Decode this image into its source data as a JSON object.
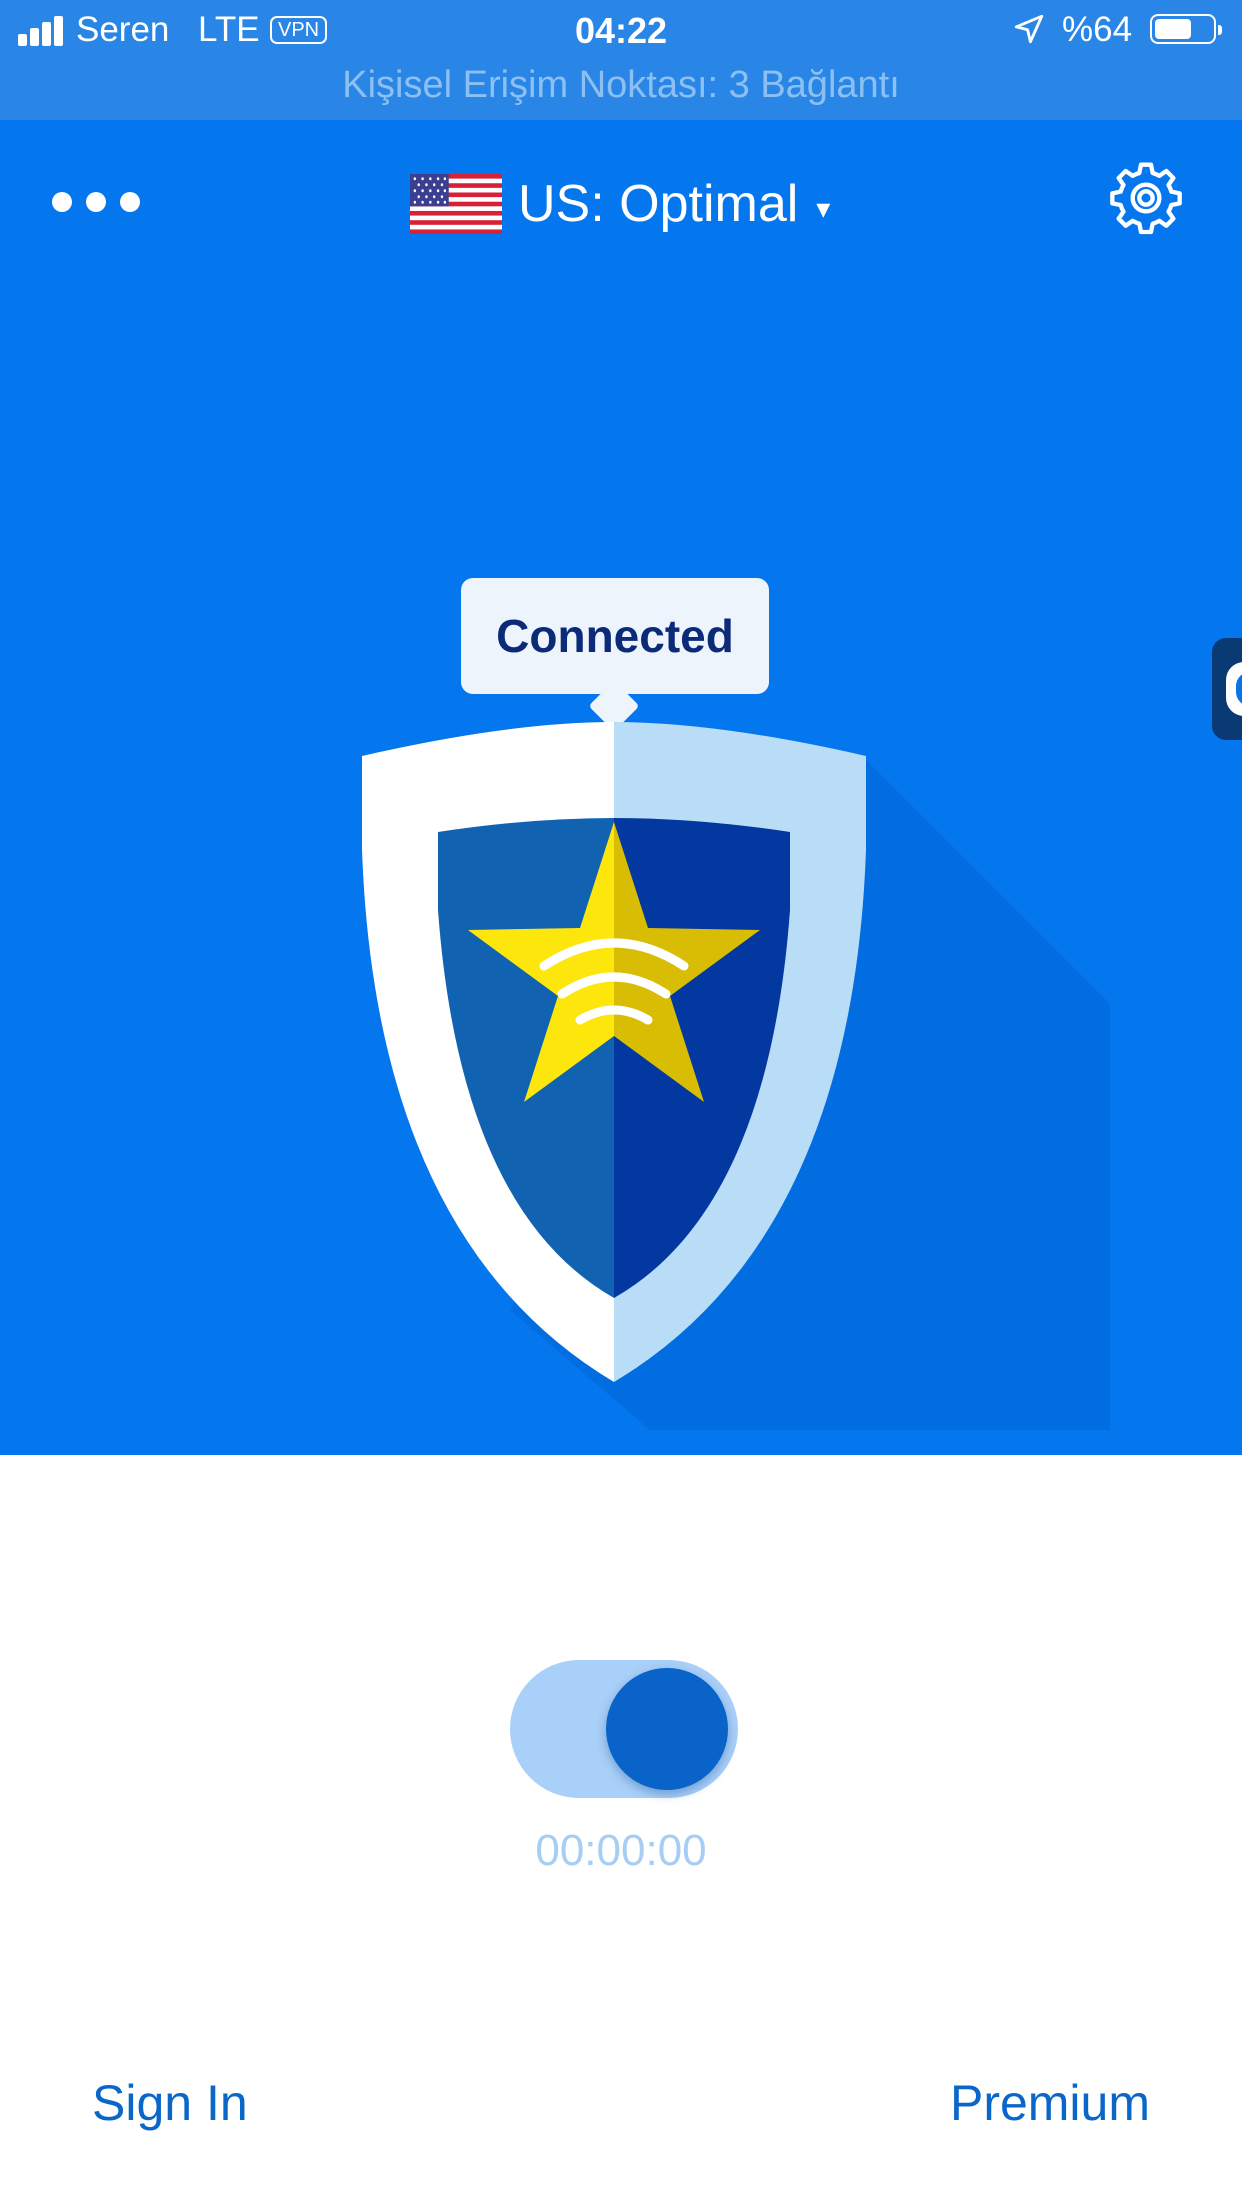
{
  "status_bar": {
    "carrier": "Seren",
    "network": "LTE",
    "vpn_badge": "VPN",
    "time": "04:22",
    "battery_percent": "%64",
    "battery_level": 0.64,
    "hotspot_text": "Kişisel Erişim Noktası: 3 Bağlantı"
  },
  "header": {
    "location_label": "US: Optimal",
    "dropdown_arrow": "▾",
    "flag_icon": "us-flag-icon",
    "more_icon": "more-dots-icon",
    "settings_icon": "gear-icon"
  },
  "hero": {
    "status_text": "Connected",
    "graphic_icon": "shield-star-wifi-icon"
  },
  "connection": {
    "toggle_on": true,
    "timer": "00:00:00"
  },
  "footer": {
    "sign_in_label": "Sign In",
    "premium_label": "Premium"
  },
  "colors": {
    "hero_background": "#0476ee",
    "status_bar_background": "#2a86e6",
    "link": "#0a67c9",
    "toggle_track": "#a9d0f8",
    "toggle_knob": "#0963c9"
  }
}
